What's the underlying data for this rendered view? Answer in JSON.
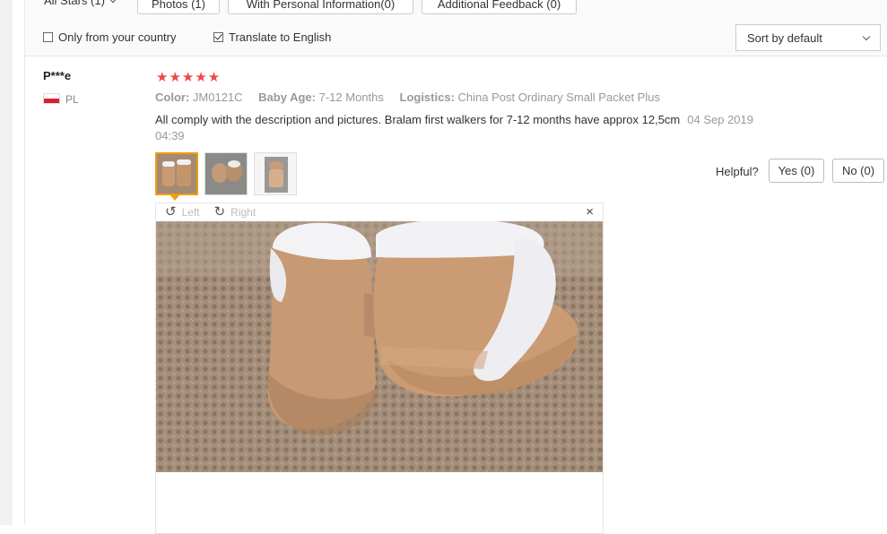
{
  "filters": {
    "stars_dropdown": "All Stars (1)",
    "photos": "Photos (1)",
    "personal": "With Personal Information(0)",
    "additional": "Additional Feedback (0)",
    "only_country": "Only from your country",
    "translate": "Translate to English",
    "translate_checked": true,
    "only_country_checked": false,
    "sort": "Sort by default"
  },
  "review": {
    "user": "P***e",
    "country": "PL",
    "rating": 5,
    "stars_text": "★★★★★",
    "color_label": "Color:",
    "color_value": "JM0121C",
    "age_label": "Baby Age:",
    "age_value": "7-12 Months",
    "logistics_label": "Logistics:",
    "logistics_value": "China Post Ordinary Small Packet Plus",
    "comment": "All comply with the description and pictures. Bralam first walkers for 7-12 months have approx 12,5cm",
    "date": "04 Sep 2019",
    "time": "04:39",
    "helpful_label": "Helpful?",
    "yes_label": "Yes (0)",
    "no_label": "No (0)"
  },
  "viewer": {
    "left_label": "Left",
    "right_label": "Right",
    "close_symbol": "×"
  },
  "icons": {
    "rotate_left": "rotate-left-icon",
    "rotate_right": "rotate-right-icon",
    "close": "close-icon",
    "checkbox": "checkbox-icon",
    "chevron": "chevron-down-icon"
  },
  "colors": {
    "star": "#f04747",
    "active_thumb": "#f39c12",
    "flag_red": "#dc1e35"
  }
}
